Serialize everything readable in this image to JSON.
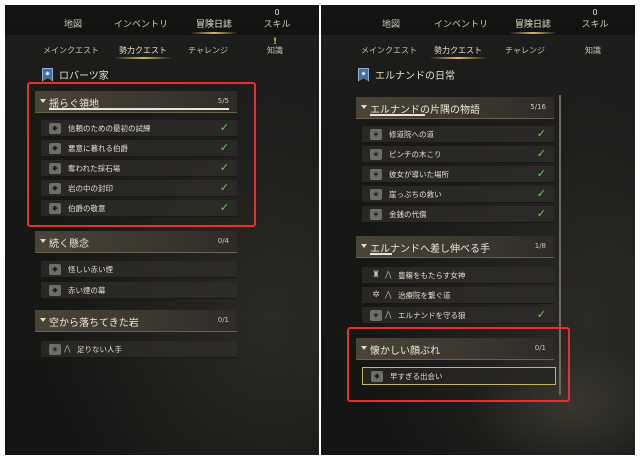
{
  "nav": {
    "tabs": [
      "地図",
      "インベントリ",
      "冒険日誌",
      "スキル"
    ],
    "skill_badge": "0",
    "subtabs": [
      "メインクエスト",
      "勢力クエスト",
      "チャレンジ",
      "知識"
    ],
    "knowledge_badge": "!"
  },
  "left": {
    "faction_title": "ロバーツ家",
    "sections": [
      {
        "title": "揺らぐ領地",
        "count": "5/5",
        "progress": 1.0,
        "items": [
          {
            "label": "信頼のための最初の試練",
            "done": true
          },
          {
            "label": "悪意に暮れる伯爵",
            "done": true
          },
          {
            "label": "奪われた採石場",
            "done": true
          },
          {
            "label": "岩の中の封印",
            "done": true
          },
          {
            "label": "伯爵の敬意",
            "done": true
          }
        ]
      },
      {
        "title": "続く懸念",
        "count": "0/4",
        "progress": 0,
        "items": [
          {
            "label": "怪しい赤い煙",
            "done": false
          },
          {
            "label": "赤い煙の幕",
            "done": false
          }
        ]
      },
      {
        "title": "空から落ちてきた岩",
        "count": "0/1",
        "progress": 0,
        "items": [
          {
            "label": "足りない人手",
            "done": false
          }
        ]
      }
    ]
  },
  "right": {
    "faction_title": "エルナンドの日常",
    "sections": [
      {
        "title": "エルナンドの片隅の物語",
        "count": "5/16",
        "progress": 0.31,
        "items": [
          {
            "label": "修道院への道",
            "done": true
          },
          {
            "label": "ピンチの木こり",
            "done": true
          },
          {
            "label": "彼女が導いた場所",
            "done": true
          },
          {
            "label": "崖っぷちの救い",
            "done": true
          },
          {
            "label": "金銭の代償",
            "done": true
          }
        ]
      },
      {
        "title": "エルナンドへ差し伸べる手",
        "count": "1/8",
        "progress": 0.125,
        "items": [
          {
            "label": "豊穣をもたらす女神",
            "done": false
          },
          {
            "label": "治療院を繋ぐ道",
            "done": false
          },
          {
            "label": "エルナンドを守る狼",
            "done": true
          }
        ]
      },
      {
        "title": "懐かしい顔ぶれ",
        "count": "0/1",
        "progress": 0,
        "items": [
          {
            "label": "早すぎる出会い",
            "done": false
          }
        ]
      }
    ]
  },
  "colors": {
    "accent_gold": "#d8b46b",
    "check_green": "#5fd35f",
    "annotation_red": "#e4312f",
    "banner_blue": "#4a6f9a"
  }
}
